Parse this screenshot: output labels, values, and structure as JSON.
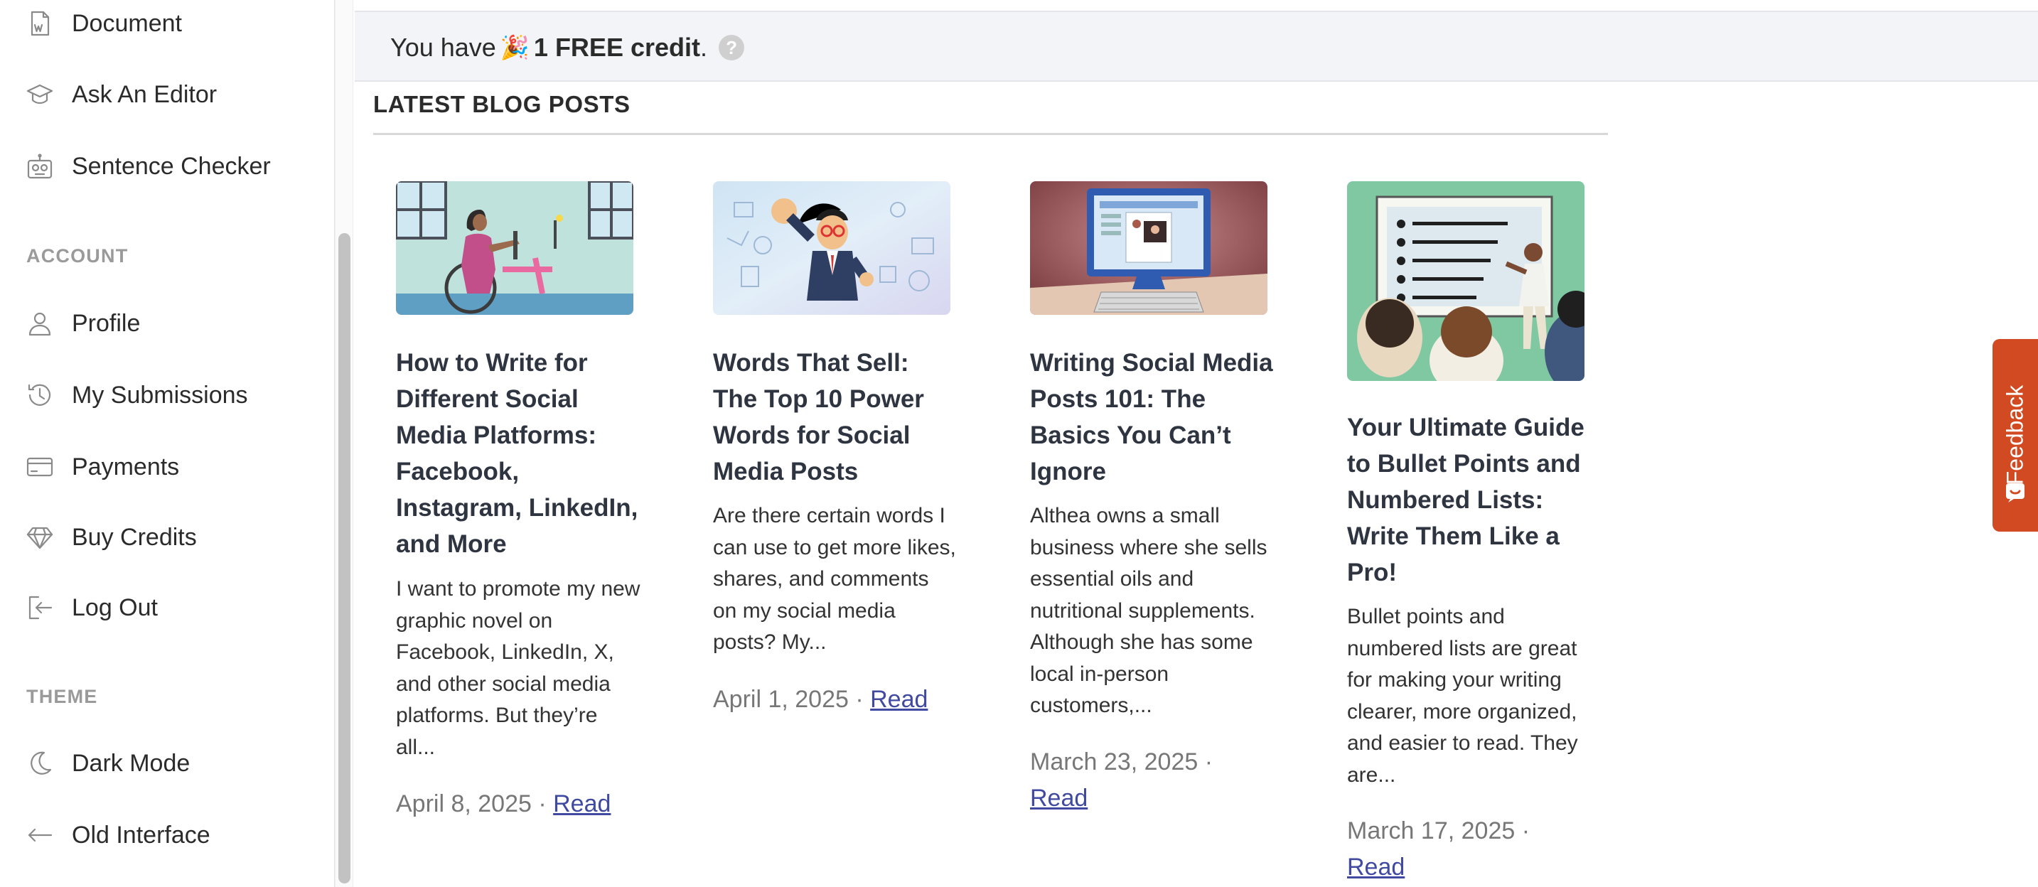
{
  "sidebar": {
    "items_top": [
      {
        "label": "Document",
        "icon": "word-document-icon"
      },
      {
        "label": "Ask An Editor",
        "icon": "graduation-cap-icon"
      },
      {
        "label": "Sentence Checker",
        "icon": "robot-icon"
      }
    ],
    "account_heading": "ACCOUNT",
    "account_items": [
      {
        "label": "Profile",
        "icon": "user-icon"
      },
      {
        "label": "My Submissions",
        "icon": "history-icon"
      },
      {
        "label": "Payments",
        "icon": "credit-card-icon"
      },
      {
        "label": "Buy Credits",
        "icon": "diamond-icon"
      },
      {
        "label": "Log Out",
        "icon": "logout-icon"
      }
    ],
    "theme_heading": "THEME",
    "theme_items": [
      {
        "label": "Dark Mode",
        "icon": "moon-icon"
      },
      {
        "label": "Old Interface",
        "icon": "arrow-left-icon"
      }
    ]
  },
  "credit_banner": {
    "prefix": "You have",
    "emoji": "🎉",
    "credits": "1 FREE credit",
    "suffix": ".",
    "help": "?"
  },
  "blog": {
    "heading": "LATEST BLOG POSTS",
    "read_label": "Read",
    "posts": [
      {
        "title": "How to Write for Different Social Media Platforms: Facebook, Instagram, LinkedIn, and More",
        "excerpt": "I want to promote my new graphic novel on Facebook, LinkedIn, X, and other social media platforms. But they’re all...",
        "date": "April 8, 2025 ·"
      },
      {
        "title": "Words That Sell: The Top 10 Power Words for Social Media Posts",
        "excerpt": "Are there certain words I can use to get more likes, shares, and comments on my social media posts? My...",
        "date": "April 1, 2025 ·"
      },
      {
        "title": "Writing Social Media Posts 101: The Basics You Can’t Ignore",
        "excerpt": "Althea owns a small business where she sells essential oils and nutritional supplements. Although she has some local in-person customers,...",
        "date": "March 23, 2025 ·"
      },
      {
        "title": "Your Ultimate Guide to Bullet Points and Numbered Lists: Write Them Like a Pro!",
        "excerpt": "Bullet points and numbered lists are great for making your writing clearer, more organized, and easier to read. They are...",
        "date": "March 17, 2025 ·"
      }
    ]
  },
  "feedback": {
    "label": "Feedback"
  },
  "colors": {
    "accent_link": "#3f4aa0",
    "feedback_bg": "#d14a21",
    "banner_bg": "#f3f4f7"
  }
}
